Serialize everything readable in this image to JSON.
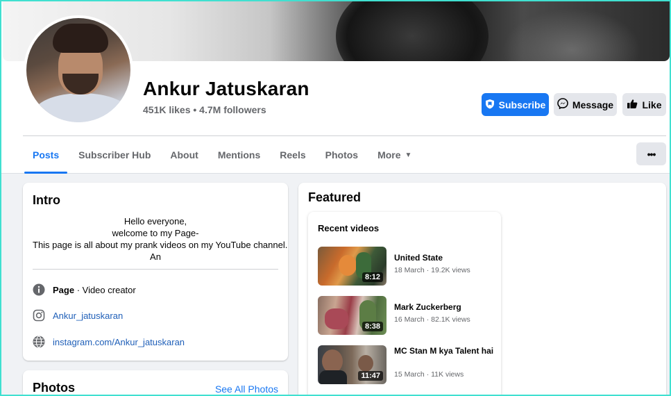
{
  "page": {
    "name": "Ankur Jatuskaran",
    "stats": "451K likes • 4.7M followers"
  },
  "actions": {
    "subscribe": "Subscribe",
    "message": "Message",
    "like": "Like",
    "more_options": "•••"
  },
  "tabs": [
    {
      "label": "Posts",
      "active": true
    },
    {
      "label": "Subscriber Hub"
    },
    {
      "label": "About"
    },
    {
      "label": "Mentions"
    },
    {
      "label": "Reels"
    },
    {
      "label": "Photos"
    },
    {
      "label": "More"
    }
  ],
  "intro": {
    "title": "Intro",
    "bio_lines": [
      "Hello everyone,",
      "welcome to my Page-",
      "This page is all about my prank videos on my YouTube channel.",
      "An"
    ],
    "category_prefix": "Page",
    "category": " · Video creator",
    "instagram_handle": "Ankur_jatuskaran",
    "website": "instagram.com/Ankur_jatuskaran"
  },
  "photos": {
    "title": "Photos",
    "see_all": "See All Photos"
  },
  "featured": {
    "title": "Featured",
    "recent_title": "Recent videos",
    "videos": [
      {
        "title": "United State",
        "date": "18 March",
        "views": "19.2K views",
        "duration": "8:12"
      },
      {
        "title": "Mark Zuckerberg",
        "date": "16 March",
        "views": "82.1K views",
        "duration": "8:38"
      },
      {
        "title": "MC Stan M kya Talent hai",
        "date": "15 March",
        "views": "11K views",
        "duration": "11:47"
      }
    ]
  },
  "colors": {
    "accent": "#1877f2",
    "frame": "#40e0d0",
    "background": "#f0f2f5"
  }
}
